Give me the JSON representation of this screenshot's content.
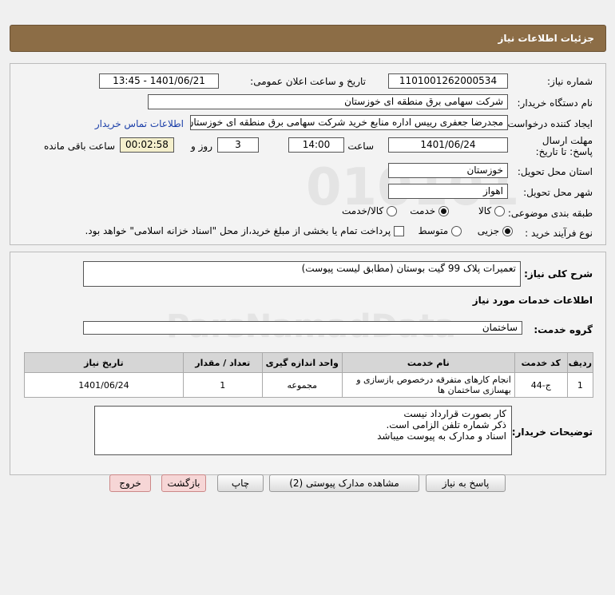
{
  "header": {
    "title": "جزئیات اطلاعات نیاز"
  },
  "form": {
    "need_number_label": "شماره نیاز:",
    "need_number": "1101001262000534",
    "announce_label": "تاریخ و ساعت اعلان عمومی:",
    "announce_value": "1401/06/21 - 13:45",
    "buyer_org_label": "نام دستگاه خریدار:",
    "buyer_org": "شرکت سهامی برق منطقه ای خوزستان",
    "creator_label": "ایجاد کننده درخواست:",
    "creator": "مجدرضا جعفری رییس اداره منابع خرید شرکت سهامی برق منطقه ای خوزستان",
    "contact_link": "اطلاعات تماس خریدار",
    "deadline_label": "مهلت ارسال پاسخ: تا تاریخ:",
    "deadline_date": "1401/06/24",
    "time_label": "ساعت",
    "deadline_time": "14:00",
    "days_value": "3",
    "days_label": "روز و",
    "remaining_time": "00:02:58",
    "remaining_label": "ساعت باقی مانده",
    "province_label": "استان محل تحویل:",
    "province": "خوزستان",
    "city_label": "شهر محل تحویل:",
    "city": "اهواز",
    "category_label": "طبقه بندی موضوعی:",
    "category_options": [
      "کالا",
      "خدمت",
      "کالا/خدمت"
    ],
    "process_label": "نوع فرآیند خرید :",
    "process_options": [
      "جزیی",
      "متوسط"
    ],
    "payment_note": "پرداخت تمام یا بخشی از مبلغ خرید،از محل \"اسناد خزانه اسلامی\" خواهد بود."
  },
  "details": {
    "summary_label": "شرح کلی نیاز:",
    "summary": "تعمیرات پلاک 99 گیت بوستان (مطابق لیست پیوست)",
    "services_title": "اطلاعات خدمات مورد نیاز",
    "service_group_label": "گروه خدمت:",
    "service_group": "ساختمان",
    "table": {
      "headers": [
        "ردیف",
        "کد خدمت",
        "نام خدمت",
        "واحد اندازه گیری",
        "تعداد / مقدار",
        "تاریخ نیاز"
      ],
      "rows": [
        [
          "1",
          "ج-44",
          "انجام کارهای متفرقه درخصوص بازسازی و بهسازی ساختمان ها",
          "مجموعه",
          "1",
          "1401/06/24"
        ]
      ]
    },
    "notes_label": "توضیحات خریدار:",
    "notes": [
      "کار بصورت قرارداد نیست",
      "ذکر شماره تلفن الزامی است.",
      "اسناد و مدارک به پیوست میباشد"
    ]
  },
  "buttons": {
    "reply": "پاسخ به نیاز",
    "attachments": "مشاهده مدارک پیوستی (2)",
    "print": "چاپ",
    "back": "بازگشت",
    "exit": "خروج"
  },
  "watermark": {
    "brand": "ParsNamadData",
    "phone": "۰۲۱-۸۸۳۴۹۶۷۰-۵"
  }
}
